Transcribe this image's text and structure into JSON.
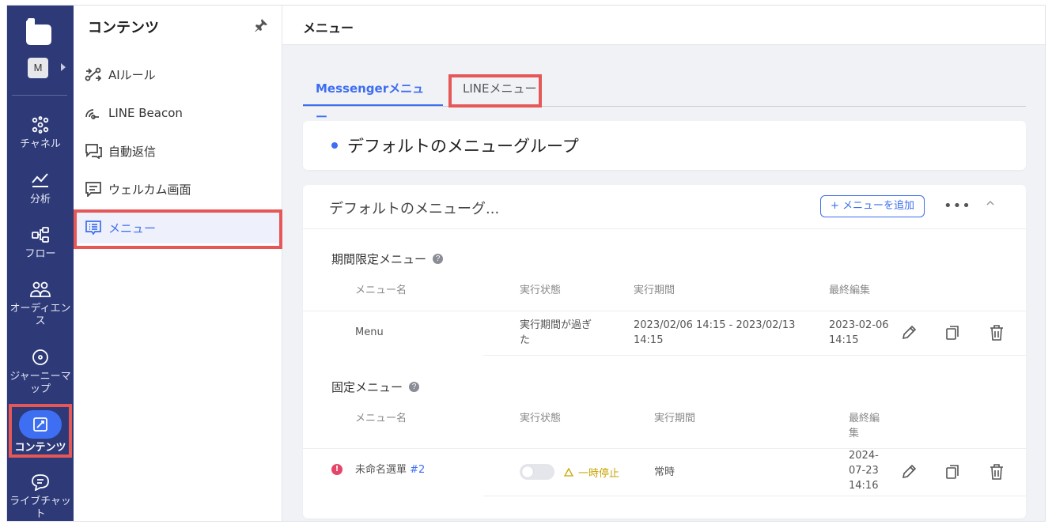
{
  "rail": {
    "workspace_initial": "M",
    "items": [
      {
        "label": "チャネル",
        "icon": "channel-icon"
      },
      {
        "label": "分析",
        "icon": "analytics-icon"
      },
      {
        "label": "フロー",
        "icon": "flow-icon"
      },
      {
        "label": "オーディエンス",
        "icon": "audience-icon"
      },
      {
        "label": "ジャーニーマップ",
        "icon": "journey-icon"
      },
      {
        "label": "コンテンツ",
        "icon": "content-icon"
      },
      {
        "label": "ライブチャット",
        "icon": "chat-icon"
      }
    ]
  },
  "sidebar": {
    "title": "コンテンツ",
    "items": [
      {
        "label": "AIルール",
        "icon": "ai-rule-icon"
      },
      {
        "label": "LINE Beacon",
        "icon": "beacon-icon"
      },
      {
        "label": "自動返信",
        "icon": "auto-reply-icon"
      },
      {
        "label": "ウェルカム画面",
        "icon": "welcome-icon"
      },
      {
        "label": "メニュー",
        "icon": "menu-icon"
      }
    ]
  },
  "header": {
    "title": "メニュー"
  },
  "tabs": [
    {
      "label": "Messengerメニュー"
    },
    {
      "label": "LINEメニュー"
    }
  ],
  "group": {
    "title": "デフォルトのメニューグループ",
    "card_title": "デフォルトのメニューグ...",
    "add_button": "+ メニューを追加",
    "more": "•••"
  },
  "limited": {
    "title": "期間限定メニュー",
    "columns": [
      "メニュー名",
      "実行状態",
      "実行期間",
      "最終編集"
    ],
    "rows": [
      {
        "name": "Menu",
        "status_line1": "実行期間が過ぎ",
        "status_line2": "た",
        "period_line1": "2023/02/06 14:15 - 2023/02/13",
        "period_line2": "14:15",
        "edited_line1": "2023-02-06",
        "edited_line2": "14:15"
      }
    ]
  },
  "fixed": {
    "title": "固定メニュー",
    "columns": [
      "メニュー名",
      "実行状態",
      "実行期間",
      "最終編",
      "集"
    ],
    "rows": [
      {
        "name": "未命名選單",
        "number": "#2",
        "status": "一時停止",
        "period": "常時",
        "edited_line1": "2024-",
        "edited_line2": "07-23",
        "edited_line3": "14:16"
      }
    ]
  },
  "colors": {
    "accent": "#3d6ef0",
    "rail": "#2e3a78",
    "highlight": "#e65757",
    "warning": "#c9a400",
    "error": "#e6456a"
  }
}
